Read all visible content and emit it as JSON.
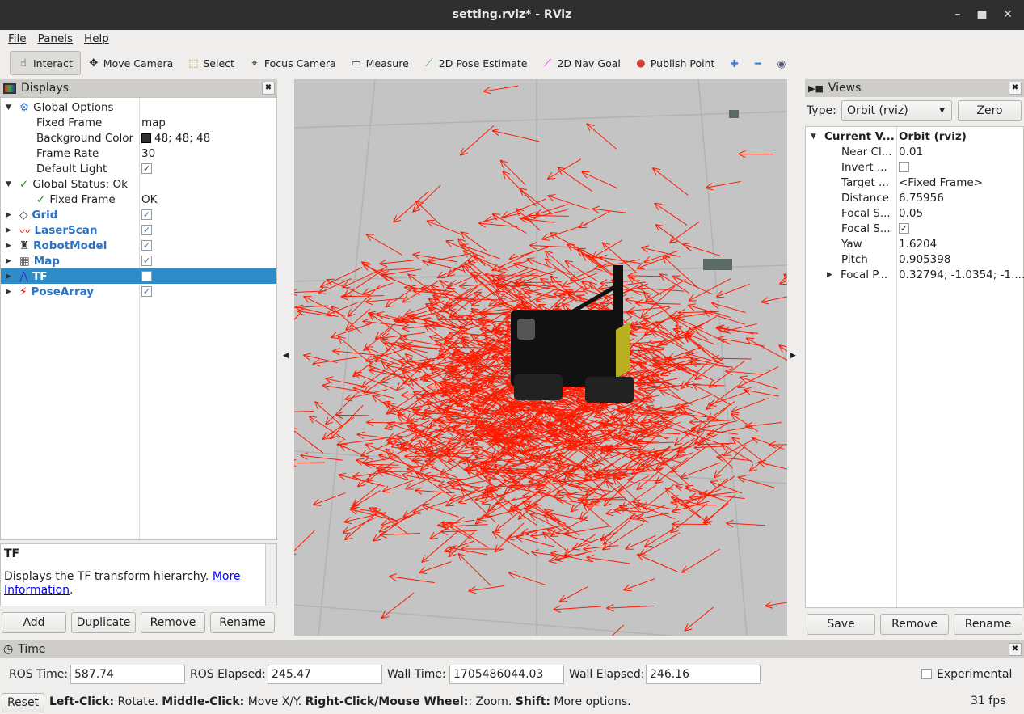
{
  "window": {
    "title": "setting.rviz* - RViz"
  },
  "menu": [
    "File",
    "Panels",
    "Help"
  ],
  "toolbar": [
    {
      "label": "Interact",
      "icon": "hand-icon",
      "active": true
    },
    {
      "label": "Move Camera",
      "icon": "move-camera-icon"
    },
    {
      "label": "Select",
      "icon": "select-icon"
    },
    {
      "label": "Focus Camera",
      "icon": "focus-camera-icon"
    },
    {
      "label": "Measure",
      "icon": "ruler-icon"
    },
    {
      "label": "2D Pose Estimate",
      "icon": "green-arrow-icon"
    },
    {
      "label": "2D Nav Goal",
      "icon": "magenta-arrow-icon"
    },
    {
      "label": "Publish Point",
      "icon": "map-pin-icon"
    }
  ],
  "displays": {
    "title": "Displays",
    "global_options": "Global Options",
    "props": [
      {
        "k": "Fixed Frame",
        "v": "map"
      },
      {
        "k": "Background Color",
        "v": "48; 48; 48",
        "color": "#303030"
      },
      {
        "k": "Frame Rate",
        "v": "30"
      },
      {
        "k": "Default Light",
        "checked": true
      }
    ],
    "global_status": "Global Status: Ok",
    "status_item": {
      "k": "Fixed Frame",
      "v": "OK"
    },
    "items": [
      {
        "label": "Grid",
        "checked": true,
        "icon": "grid-icon"
      },
      {
        "label": "LaserScan",
        "checked": true,
        "icon": "laserscan-icon"
      },
      {
        "label": "RobotModel",
        "checked": true,
        "icon": "robot-model-icon"
      },
      {
        "label": "Map",
        "checked": true,
        "icon": "map-icon"
      },
      {
        "label": "TF",
        "checked": false,
        "selected": true,
        "icon": "tf-icon"
      },
      {
        "label": "PoseArray",
        "checked": true,
        "icon": "pose-array-icon"
      }
    ],
    "desc_title": "TF",
    "desc_text": "Displays the TF transform hierarchy. ",
    "desc_link1": "More",
    "desc_link2": "Information",
    "buttons": [
      "Add",
      "Duplicate",
      "Remove",
      "Rename"
    ]
  },
  "views": {
    "title": "Views",
    "type_label": "Type:",
    "type_value": "Orbit (rviz)",
    "zero": "Zero",
    "current_k": "Current V...",
    "current_v": "Orbit (rviz)",
    "props": [
      {
        "k": "Near Cl...",
        "v": "0.01"
      },
      {
        "k": "Invert ...",
        "checked": false
      },
      {
        "k": "Target ...",
        "v": "<Fixed Frame>"
      },
      {
        "k": "Distance",
        "v": "6.75956"
      },
      {
        "k": "Focal S...",
        "v": "0.05"
      },
      {
        "k": "Focal S...",
        "checked": true
      },
      {
        "k": "Yaw",
        "v": "1.6204"
      },
      {
        "k": "Pitch",
        "v": "0.905398"
      },
      {
        "k": "Focal P...",
        "v": "0.32794; -1.0354; -1....",
        "expandable": true
      }
    ],
    "buttons": [
      "Save",
      "Remove",
      "Rename"
    ]
  },
  "time": {
    "title": "Time",
    "ros_time_label": "ROS Time:",
    "ros_time": "587.74",
    "ros_elapsed_label": "ROS Elapsed:",
    "ros_elapsed": "245.47",
    "wall_time_label": "Wall Time:",
    "wall_time": "1705486044.03",
    "wall_elapsed_label": "Wall Elapsed:",
    "wall_elapsed": "246.16",
    "experimental": "Experimental"
  },
  "status": {
    "reset": "Reset",
    "hint": [
      [
        "Left-Click:",
        " Rotate. "
      ],
      [
        "Middle-Click:",
        " Move X/Y. "
      ],
      [
        "Right-Click/Mouse Wheel:",
        ": Zoom. "
      ],
      [
        "Shift:",
        " More options."
      ]
    ],
    "fps": "31 fps"
  },
  "viewport": {
    "background": "#c4c4c4",
    "arrow_color": "#ff1a00"
  }
}
